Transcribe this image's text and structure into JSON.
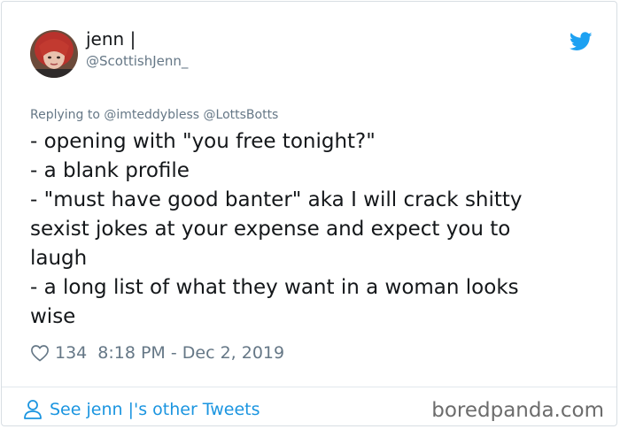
{
  "tweet": {
    "author_name": "jenn |",
    "author_handle": "@ScottishJenn_",
    "replying_prefix": "Replying to",
    "replying_to": [
      "@imteddybless",
      "@LottsBotts"
    ],
    "body_lines": [
      "- opening with \"you free tonight?\"",
      "- a blank profile",
      "- \"must have good banter\" aka I will crack shitty",
      "sexist jokes at your expense and expect you to",
      "laugh",
      "- a long list of what they want in a woman looks",
      "wise"
    ],
    "likes": "134",
    "timestamp": "8:18 PM - Dec 2, 2019"
  },
  "footer": {
    "other_tweets_label": "See jenn |'s other Tweets",
    "watermark": "boredpanda.com"
  },
  "icons": {
    "brand": "twitter-bird-icon",
    "like": "heart-icon",
    "profile": "person-icon"
  },
  "colors": {
    "twitter_blue": "#1da1f2",
    "link_blue": "#1b95e0",
    "muted": "#657786",
    "text": "#14171a"
  }
}
